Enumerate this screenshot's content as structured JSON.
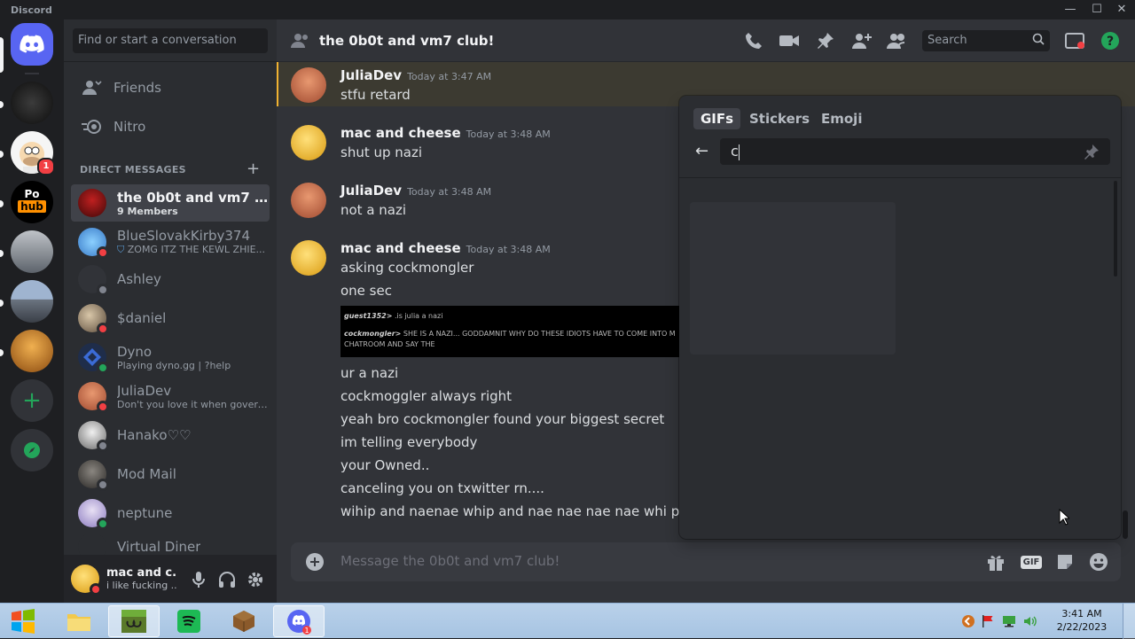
{
  "app": {
    "title": "Discord"
  },
  "dm_sidebar": {
    "search_placeholder": "Find or start a conversation",
    "nav": [
      {
        "label": "Friends",
        "icon": "friends-icon"
      },
      {
        "label": "Nitro",
        "icon": "nitro-icon"
      }
    ],
    "header": "DIRECT MESSAGES",
    "items": [
      {
        "name": "the 0b0t and vm7 club!",
        "sub": "9 Members",
        "status": "none",
        "active": true
      },
      {
        "name": "BlueSlovakKirby374",
        "sub": "ZOMG ITZ THE KEWL ZHIE...",
        "status": "dnd"
      },
      {
        "name": "Ashley",
        "sub": "",
        "status": "offline"
      },
      {
        "name": "$daniel",
        "sub": "",
        "status": "dnd"
      },
      {
        "name": "Dyno",
        "sub": "Playing dyno.gg | ?help",
        "status": "online"
      },
      {
        "name": "JuliaDev",
        "sub": "Don't you love it when govern...",
        "status": "dnd"
      },
      {
        "name": "Hanako♡♡",
        "sub": "",
        "status": "offline"
      },
      {
        "name": "Mod Mail",
        "sub": "",
        "status": "offline"
      },
      {
        "name": "neptune",
        "sub": "",
        "status": "online"
      },
      {
        "name": "Virtual Diner",
        "sub": "",
        "status": "none"
      }
    ]
  },
  "guilds": {
    "badge_count": "1"
  },
  "user_panel": {
    "name": "mac and c...",
    "status": "i like fucking ..."
  },
  "channel": {
    "name": "the 0b0t and vm7 club!",
    "search_placeholder": "Search",
    "composer_placeholder": "Message the 0b0t and vm7 club!"
  },
  "messages": [
    {
      "author": "JuliaDev",
      "time": "Today at 3:47 AM",
      "lines": [
        "stfu retard"
      ],
      "highlight": true
    },
    {
      "author": "mac and cheese",
      "time": "Today at 3:48 AM",
      "lines": [
        "shut up nazi"
      ]
    },
    {
      "author": "JuliaDev",
      "time": "Today at 3:48 AM",
      "lines": [
        "not a nazi"
      ]
    },
    {
      "author": "mac and cheese",
      "time": "Today at 3:48 AM",
      "lines": [
        "asking cockmongler",
        "one sec"
      ],
      "embed": {
        "line1_user": "guest1352>",
        "line1_text": ".is julia a nazi",
        "line2_user": "cockmongler>",
        "line2_text": "SHE IS A NAZI... GODDAMNIT WHY DO THESE IDIOTS HAVE TO COME INTO M",
        "line3_text": "CHATROOM AND SAY THE"
      },
      "lines_after": [
        "ur a nazi",
        "cockmoggler always right",
        "yeah bro cockmongler found your biggest secret",
        "im telling everybody",
        "your Owned..",
        "canceling you on txwitter rn....",
        "wihip and naenae whip and nae nae nae nae whi p whip w"
      ]
    }
  ],
  "picker": {
    "tabs": [
      "GIFs",
      "Stickers",
      "Emoji"
    ],
    "active_tab": "GIFs",
    "query": "c"
  },
  "composer_buttons": {
    "gif_label": "GIF"
  },
  "taskbar": {
    "time": "3:41 AM",
    "date": "2/22/2023"
  },
  "colors": {
    "accent": "#5865f2",
    "dnd": "#f23f43",
    "online": "#23a55a",
    "mention": "#f0b232"
  }
}
